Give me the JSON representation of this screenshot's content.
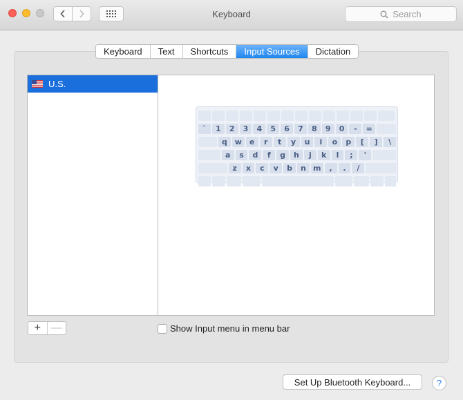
{
  "window": {
    "title": "Keyboard"
  },
  "toolbar": {
    "back_icon": "chevron-left-icon",
    "forward_icon": "chevron-right-icon",
    "grid_icon": "show-all-grid-icon",
    "search_placeholder": "Search"
  },
  "tabs": [
    {
      "label": "Keyboard",
      "active": false
    },
    {
      "label": "Text",
      "active": false
    },
    {
      "label": "Shortcuts",
      "active": false
    },
    {
      "label": "Input Sources",
      "active": true
    },
    {
      "label": "Dictation",
      "active": false
    }
  ],
  "sources": {
    "items": [
      {
        "label": "U.S.",
        "flag": "us-flag-icon",
        "selected": true
      }
    ]
  },
  "keyboard": {
    "row1": [
      "`",
      "1",
      "2",
      "3",
      "4",
      "5",
      "6",
      "7",
      "8",
      "9",
      "0",
      "-",
      "="
    ],
    "row2": [
      "q",
      "w",
      "e",
      "r",
      "t",
      "y",
      "u",
      "i",
      "o",
      "p",
      "[",
      "]",
      "\\"
    ],
    "row3": [
      "a",
      "s",
      "d",
      "f",
      "g",
      "h",
      "j",
      "k",
      "l",
      ";",
      "'"
    ],
    "row4": [
      "z",
      "x",
      "c",
      "v",
      "b",
      "n",
      "m",
      ",",
      ".",
      "/"
    ]
  },
  "controls": {
    "add_label": "+",
    "remove_label": "—",
    "show_input_menu_label": "Show Input menu in menu bar",
    "show_input_menu_checked": false,
    "bluetooth_button_label": "Set Up Bluetooth Keyboard...",
    "help_label": "?"
  },
  "colors": {
    "selection": "#1a6fdc",
    "active_tab": "#1f86ef"
  }
}
